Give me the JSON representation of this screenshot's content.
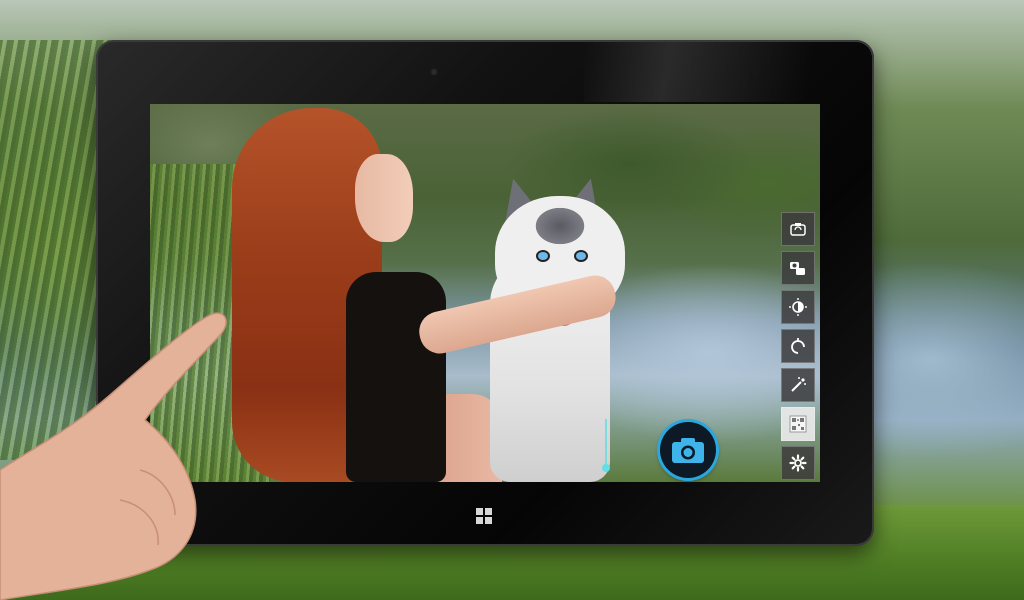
{
  "scene": {
    "device": "windows-tablet",
    "app": "camera"
  },
  "icons": {
    "tablet_home": "windows-logo-icon",
    "shutter": "camera-icon",
    "toolbar": [
      "switch-camera-icon",
      "video-mode-icon",
      "brightness-icon",
      "timer-icon",
      "effects-icon",
      "qr-code-icon",
      "settings-gear-icon"
    ]
  },
  "colors": {
    "shutter_ring": "#2aa7e0",
    "shutter_icon": "#3fb4ea",
    "toolbar_bg": "#3c3c3c",
    "tablet_bezel": "#111111",
    "focus_indicator": "#5fe0e8"
  }
}
